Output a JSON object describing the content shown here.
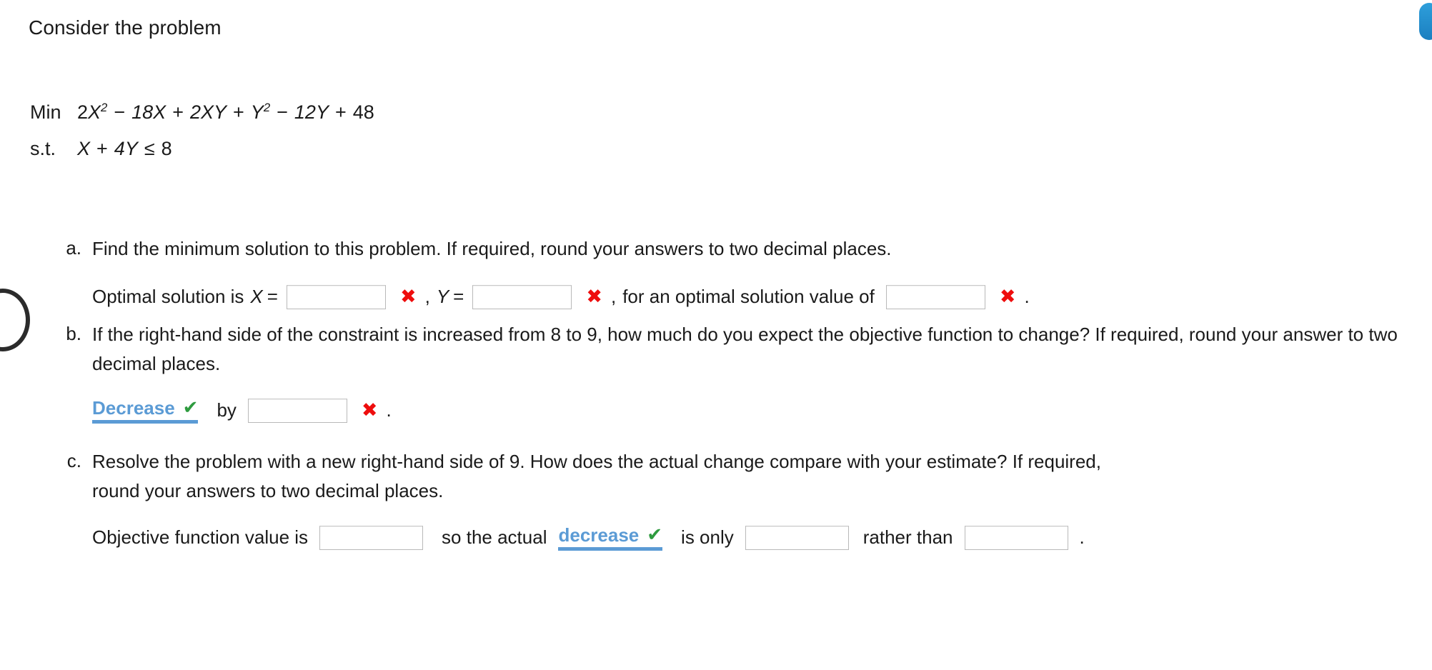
{
  "intro": {
    "text": "Consider the problem"
  },
  "model": {
    "objective_tag": "Min",
    "objective_parts": {
      "t1": "2X",
      "t1_exp": "2",
      "op1": "−",
      "t2": "18X",
      "op2": "+",
      "t3": "2XY",
      "op3": "+",
      "t4": "Y",
      "t4_exp": "2",
      "op4": "−",
      "t5": "12Y",
      "op5": "+",
      "t6": "48"
    },
    "objective_plain": "2X2 − 18X + 2XY + Y2 − 12Y + 48",
    "constraint_tag": "s.t.",
    "constraint_parts": {
      "lhs_a": "X",
      "op1": "+",
      "lhs_b": "4Y",
      "rel": "≤",
      "rhs": "8"
    },
    "constraint_plain": "X + 4Y ≤ 8"
  },
  "questions": [
    {
      "label": "a.",
      "prompt": "Find the minimum solution to this problem. If required, round your answers to two decimal places.",
      "answer": {
        "lead": "Optimal solution is",
        "var_x": "X",
        "eq1": "=",
        "field_x_value": "",
        "mark1": "✖",
        "comma1": ",",
        "var_y": "Y",
        "eq2": "=",
        "field_y_value": "",
        "mark2": "✖",
        "comma2": ",",
        "mid": "for an optimal solution value of",
        "field_obj_value": "",
        "mark3": "✖",
        "end": "."
      }
    },
    {
      "label": "b.",
      "prompt": "If the right-hand side of the constraint is increased from 8 to 9, how much do you expect the objective function to change? If required, round your answer to two decimal places.",
      "answer": {
        "select_label": "Decrease",
        "select_check": "✔",
        "by": "by",
        "field_value": "",
        "mark": "✖",
        "end": "."
      }
    },
    {
      "label": "c.",
      "prompt": "Resolve the problem with a new right-hand side of 9. How does the actual change compare with your estimate? If required, round your answers to two decimal places.",
      "answer": {
        "lead": "Objective function value is",
        "field_objective_value": "",
        "mid1": "so the actual",
        "select_label": "decrease",
        "select_check": "✔",
        "mid2": "is only",
        "field_actual_value": "",
        "mid3": "rather than",
        "field_estimate_value": "",
        "end": "."
      }
    }
  ],
  "decorations": {
    "cursor_ring": "cursor-ring",
    "edge_tab": "edge-tab"
  },
  "colors": {
    "accent_blue": "#5b9bd5",
    "check_green": "#2e9b3f",
    "error_red": "#ee0d0d",
    "text": "#1a1a1a",
    "field_border": "#b9b9b9"
  }
}
